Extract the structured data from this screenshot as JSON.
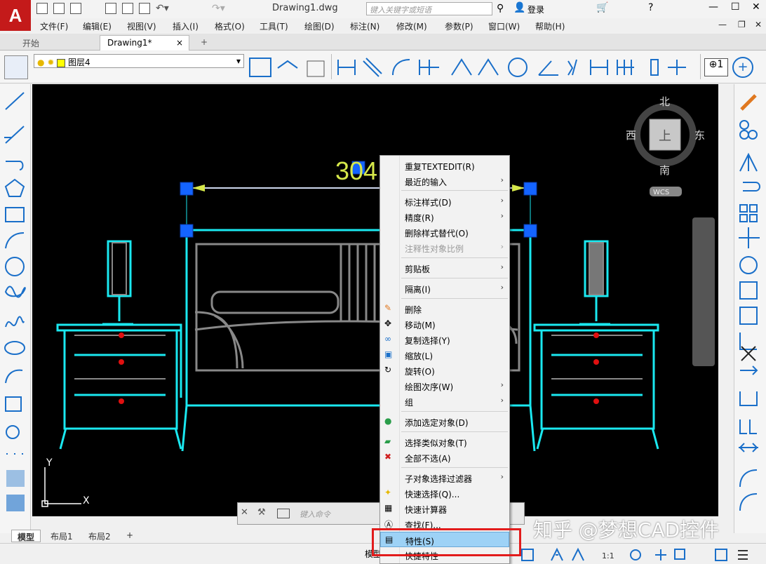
{
  "app": {
    "logo": "A",
    "doc_title": "Drawing1.dwg",
    "search_placeholder": "键入关键字或短语",
    "login": "登录"
  },
  "menubar": [
    "文件(F)",
    "编辑(E)",
    "视图(V)",
    "插入(I)",
    "格式(O)",
    "工具(T)",
    "绘图(D)",
    "标注(N)",
    "修改(M)",
    "参数(P)",
    "窗口(W)",
    "帮助(H)"
  ],
  "tabs": {
    "start": "开始",
    "drawing": "Drawing1*",
    "close": "×",
    "add": "+"
  },
  "layer": {
    "current": "图层4"
  },
  "viewcube": {
    "north": "北",
    "south": "南",
    "east": "东",
    "west": "西",
    "top": "上",
    "wcs": "WCS"
  },
  "canvas": {
    "dimension_text": "304",
    "ucs_x": "X",
    "ucs_y": "Y"
  },
  "command": {
    "placeholder": "键入命令"
  },
  "layout_tabs": [
    "模型",
    "布局1",
    "布局2"
  ],
  "status": {
    "model": "模型",
    "scale": "1:1"
  },
  "context_menu": {
    "items": [
      {
        "label": "重复TEXTEDIT(R)",
        "arrow": false,
        "disabled": false
      },
      {
        "label": "最近的输入",
        "arrow": true,
        "disabled": false
      },
      {
        "label": "标注样式(D)",
        "arrow": true,
        "disabled": false
      },
      {
        "label": "精度(R)",
        "arrow": true,
        "disabled": false
      },
      {
        "label": "删除样式替代(O)",
        "arrow": false,
        "disabled": false
      },
      {
        "label": "注释性对象比例",
        "arrow": true,
        "disabled": true
      },
      {
        "label": "剪贴板",
        "arrow": true,
        "disabled": false
      },
      {
        "label": "隔离(I)",
        "arrow": true,
        "disabled": false
      },
      {
        "label": "删除",
        "arrow": false,
        "disabled": false,
        "icon": "eraser-icon"
      },
      {
        "label": "移动(M)",
        "arrow": false,
        "disabled": false,
        "icon": "move-icon"
      },
      {
        "label": "复制选择(Y)",
        "arrow": false,
        "disabled": false,
        "icon": "copy-icon"
      },
      {
        "label": "缩放(L)",
        "arrow": false,
        "disabled": false,
        "icon": "scale-icon"
      },
      {
        "label": "旋转(O)",
        "arrow": false,
        "disabled": false,
        "icon": "rotate-icon"
      },
      {
        "label": "绘图次序(W)",
        "arrow": true,
        "disabled": false
      },
      {
        "label": "组",
        "arrow": true,
        "disabled": false
      },
      {
        "label": "添加选定对象(D)",
        "arrow": false,
        "disabled": false,
        "icon": "add-selected-icon"
      },
      {
        "label": "选择类似对象(T)",
        "arrow": false,
        "disabled": false,
        "icon": "select-similar-icon"
      },
      {
        "label": "全部不选(A)",
        "arrow": false,
        "disabled": false,
        "icon": "deselect-all-icon"
      },
      {
        "label": "子对象选择过滤器",
        "arrow": true,
        "disabled": false
      },
      {
        "label": "快速选择(Q)...",
        "arrow": false,
        "disabled": false,
        "icon": "quick-select-icon"
      },
      {
        "label": "快速计算器",
        "arrow": false,
        "disabled": false,
        "icon": "calculator-icon"
      },
      {
        "label": "查找(F)...",
        "arrow": false,
        "disabled": false,
        "icon": "find-icon"
      },
      {
        "label": "特性(S)",
        "arrow": false,
        "disabled": false,
        "icon": "properties-icon",
        "highlighted": true
      },
      {
        "label": "快捷特性",
        "arrow": false,
        "disabled": false
      }
    ]
  },
  "watermark": "知乎 @梦想CAD控件",
  "colors": {
    "cyan": "#1ae8f0",
    "grip": "#1464ff",
    "highlight": "#9dd2f6",
    "red_box": "#e21c1c",
    "logo": "#c41a1a"
  }
}
